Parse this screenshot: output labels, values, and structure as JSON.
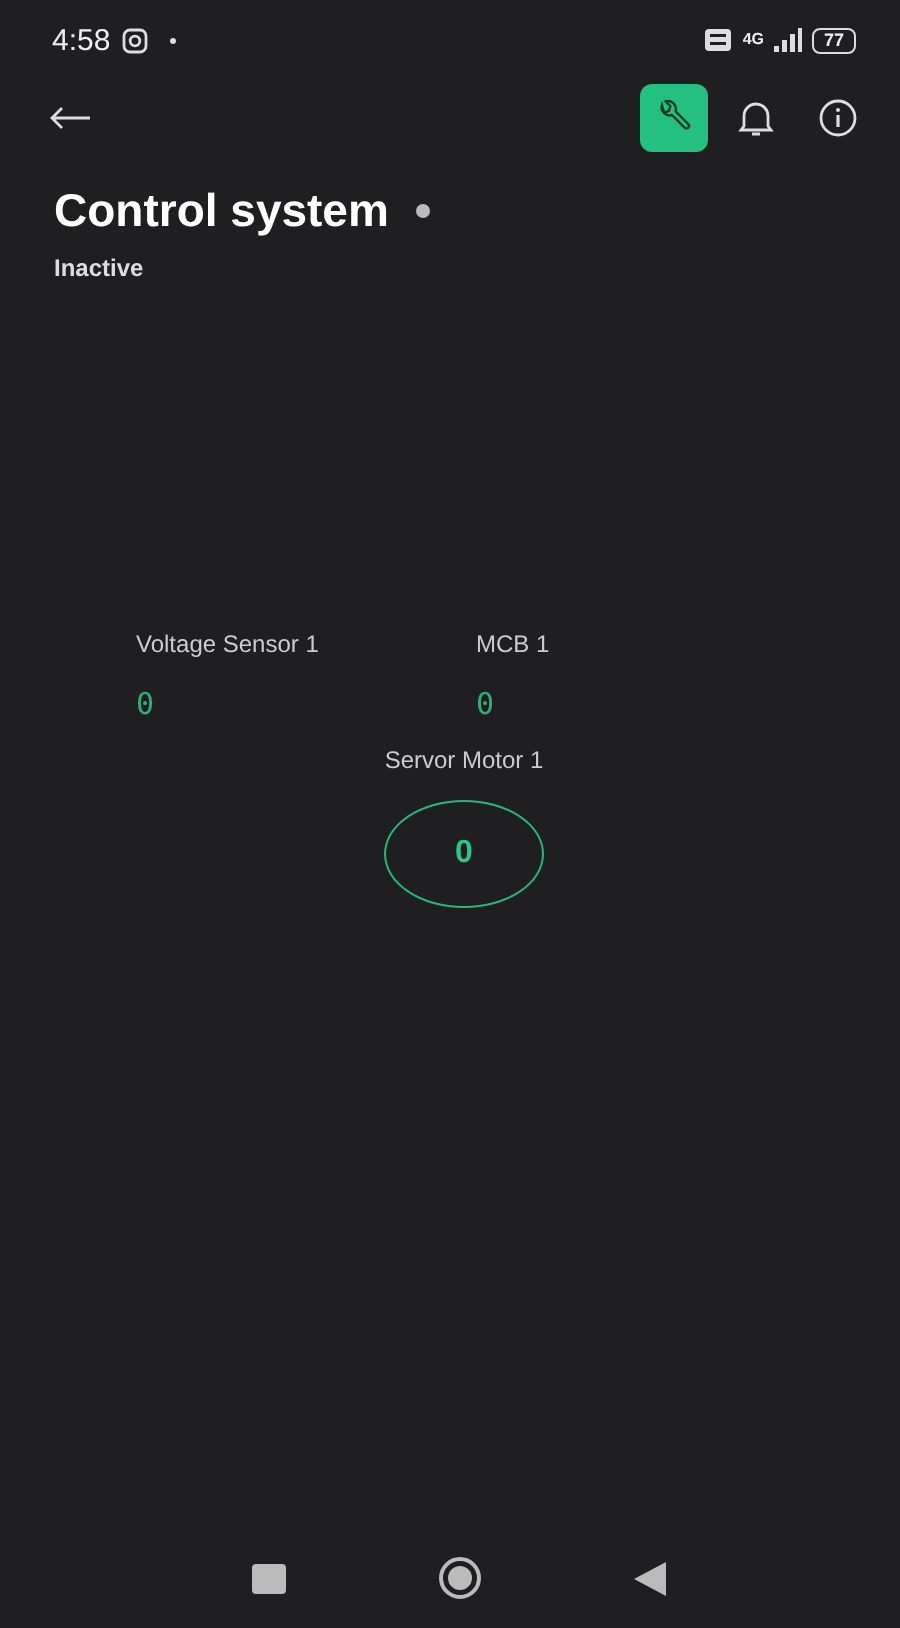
{
  "status_bar": {
    "time": "4:58",
    "network": "4G",
    "battery": "77"
  },
  "header": {
    "title": "Control system",
    "status": "Inactive"
  },
  "widgets": [
    {
      "kind": "value",
      "label": "Voltage Sensor 1",
      "value": "0"
    },
    {
      "kind": "value",
      "label": "MCB 1",
      "value": "0"
    },
    {
      "kind": "gauge",
      "label": "Servor Motor 1",
      "value": "0"
    }
  ]
}
